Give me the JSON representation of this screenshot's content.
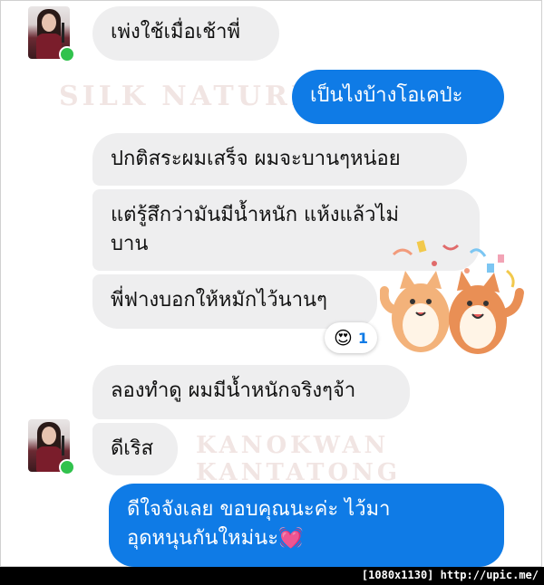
{
  "watermarks": {
    "top": "SILK NATURE",
    "middle": "KANOKWAN KANTATONG"
  },
  "messages": [
    {
      "side": "in",
      "text": "เพ่งใช้เมื่อเช้าพี่"
    },
    {
      "side": "out",
      "text": "เป็นไงบ้างโอเคป่ะ"
    },
    {
      "side": "in",
      "text": "ปกติสระผมเสร็จ ผมจะบานๆหน่อย"
    },
    {
      "side": "in",
      "line1": "แต่รู้สึกว่ามันมีน้ำหนัก แห้งแล้วไม่",
      "line2": "บาน"
    },
    {
      "side": "in",
      "text": "พี่ฟางบอกให้หมักไว้นานๆ"
    },
    {
      "side": "in",
      "text": "ลองทำดู ผมมีน้ำหนักจริงๆจ้า"
    },
    {
      "side": "in",
      "text": "ดีเริส"
    },
    {
      "side": "out",
      "line1": "ดีใจจังเลย ขอบคุณนะค่ะ ไว้มา",
      "line2": "อุดหนุนกันใหม่นะ💓"
    }
  ],
  "reaction": {
    "emoji": "😍",
    "count": "1"
  },
  "footer": {
    "credit": "[1080x1130] http://upic.me/"
  },
  "colors": {
    "outgoing": "#0f7be6",
    "incoming": "#eeeeef",
    "online": "#31c24d"
  },
  "icons": {
    "sticker": "two-cats-celebrating-sticker",
    "avatar": "contact-avatar"
  }
}
